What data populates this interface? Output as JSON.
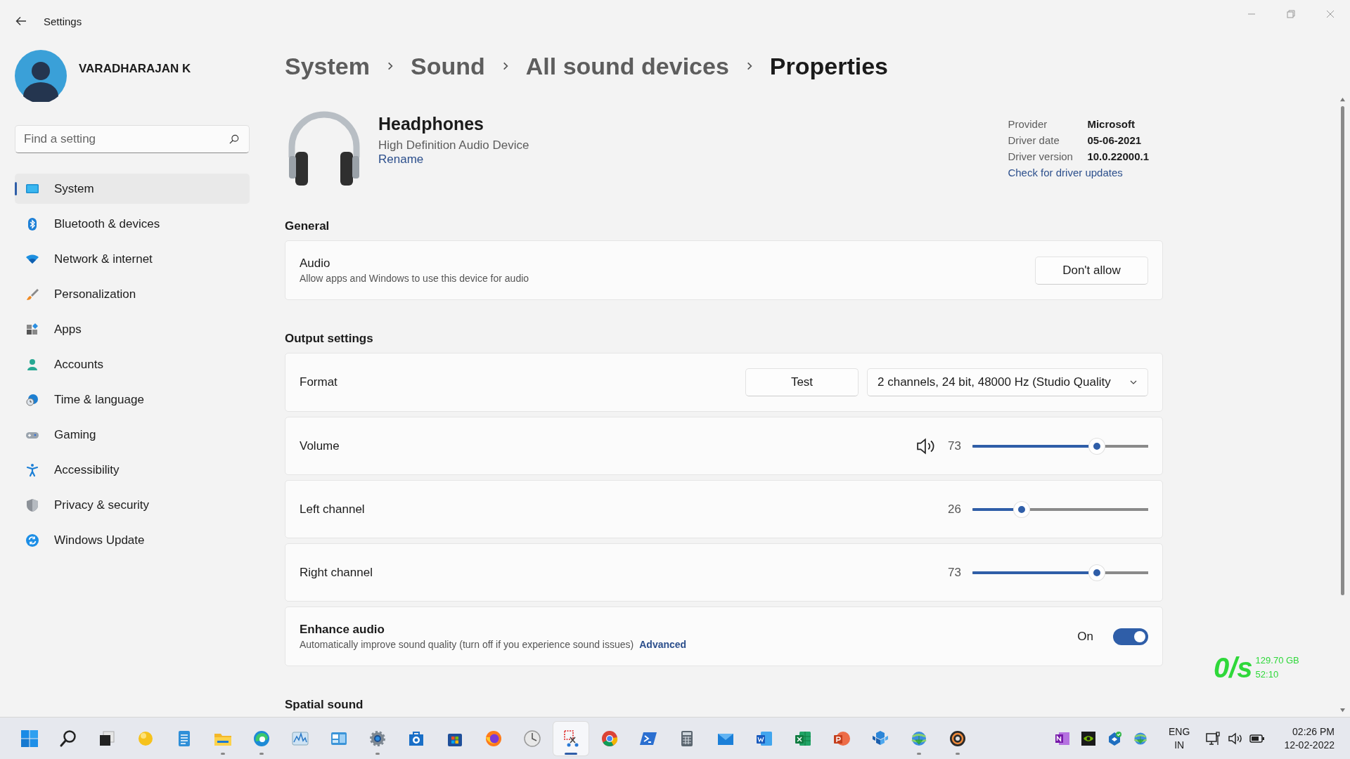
{
  "window": {
    "title": "Settings"
  },
  "user": {
    "name": "VARADHARAJAN K"
  },
  "search": {
    "placeholder": "Find a setting"
  },
  "nav": [
    {
      "label": "System",
      "kind": "system",
      "selected": true
    },
    {
      "label": "Bluetooth & devices",
      "kind": "bluetooth",
      "selected": false
    },
    {
      "label": "Network & internet",
      "kind": "network",
      "selected": false
    },
    {
      "label": "Personalization",
      "kind": "personalization",
      "selected": false
    },
    {
      "label": "Apps",
      "kind": "apps",
      "selected": false
    },
    {
      "label": "Accounts",
      "kind": "accounts",
      "selected": false
    },
    {
      "label": "Time & language",
      "kind": "time",
      "selected": false
    },
    {
      "label": "Gaming",
      "kind": "gaming",
      "selected": false
    },
    {
      "label": "Accessibility",
      "kind": "accessibility",
      "selected": false
    },
    {
      "label": "Privacy & security",
      "kind": "privacy",
      "selected": false
    },
    {
      "label": "Windows Update",
      "kind": "update",
      "selected": false
    }
  ],
  "breadcrumb": [
    {
      "label": "System",
      "current": false
    },
    {
      "label": "Sound",
      "current": false
    },
    {
      "label": "All sound devices",
      "current": false
    },
    {
      "label": "Properties",
      "current": true
    }
  ],
  "device": {
    "name": "Headphones",
    "description": "High Definition Audio Device",
    "rename": "Rename"
  },
  "driver": {
    "rows": [
      {
        "label": "Provider",
        "value": "Microsoft"
      },
      {
        "label": "Driver date",
        "value": "05-06-2021"
      },
      {
        "label": "Driver version",
        "value": "10.0.22000.1"
      }
    ],
    "link": "Check for driver updates"
  },
  "sections": [
    {
      "title": "General",
      "cards": [
        {
          "kind": "button",
          "title": "Audio",
          "description": "Allow apps and Windows to use this device for audio",
          "button": "Don't allow"
        }
      ]
    },
    {
      "title": "Output settings",
      "cards": [
        {
          "kind": "format",
          "title": "Format",
          "button": "Test",
          "dropdown": "2 channels, 24 bit, 48000 Hz (Studio Quality"
        },
        {
          "kind": "slider",
          "title": "Volume",
          "speaker": true,
          "reading": "73",
          "level": 0.73
        },
        {
          "kind": "slider",
          "title": "Left channel",
          "speaker": false,
          "reading": "26",
          "level": 0.26
        },
        {
          "kind": "slider",
          "title": "Right channel",
          "speaker": false,
          "reading": "73",
          "level": 0.73
        },
        {
          "kind": "toggle",
          "title": "Enhance audio",
          "description": "Automatically improve sound quality (turn off if you experience sound issues)",
          "link": "Advanced",
          "state_label": "On",
          "on": true
        }
      ]
    },
    {
      "title": "Spatial sound"
    }
  ],
  "net_meter": {
    "speed": "0/s",
    "total": "129.70 GB",
    "time": "52:10"
  },
  "taskbar": {
    "apps": [
      {
        "kind": "start",
        "running": false,
        "selected": false
      },
      {
        "kind": "search",
        "running": false,
        "selected": false
      },
      {
        "kind": "taskview",
        "running": false,
        "selected": false
      },
      {
        "kind": "orb",
        "running": false,
        "selected": false
      },
      {
        "kind": "notepad",
        "running": false,
        "selected": false
      },
      {
        "kind": "explorer",
        "running": true,
        "selected": false
      },
      {
        "kind": "edge",
        "running": true,
        "selected": false
      },
      {
        "kind": "chart",
        "running": false,
        "selected": false
      },
      {
        "kind": "dashboard",
        "running": false,
        "selected": false
      },
      {
        "kind": "settings",
        "running": true,
        "selected": false
      },
      {
        "kind": "bag",
        "running": false,
        "selected": false
      },
      {
        "kind": "store",
        "running": false,
        "selected": false
      },
      {
        "kind": "firefox",
        "running": false,
        "selected": false
      },
      {
        "kind": "clock",
        "running": false,
        "selected": false
      },
      {
        "kind": "snip",
        "running": true,
        "selected": true
      },
      {
        "kind": "chrome",
        "running": false,
        "selected": false
      },
      {
        "kind": "terminal",
        "running": false,
        "selected": false
      },
      {
        "kind": "calculator",
        "running": false,
        "selected": false
      },
      {
        "kind": "mail",
        "running": false,
        "selected": false
      },
      {
        "kind": "word",
        "running": false,
        "selected": false
      },
      {
        "kind": "excel",
        "running": false,
        "selected": false
      },
      {
        "kind": "powerpoint",
        "running": false,
        "selected": false
      },
      {
        "kind": "cubes",
        "running": false,
        "selected": false
      },
      {
        "kind": "idm",
        "running": true,
        "selected": false
      },
      {
        "kind": "disc",
        "running": true,
        "selected": false
      }
    ],
    "tray": [
      {
        "kind": "onenote"
      },
      {
        "kind": "nvidia"
      },
      {
        "kind": "sync"
      },
      {
        "kind": "idm"
      }
    ],
    "language": "ENG",
    "region": "IN",
    "status": [
      {
        "kind": "network"
      },
      {
        "kind": "volume"
      },
      {
        "kind": "battery"
      }
    ],
    "time": "02:26 PM",
    "date": "12-02-2022"
  }
}
